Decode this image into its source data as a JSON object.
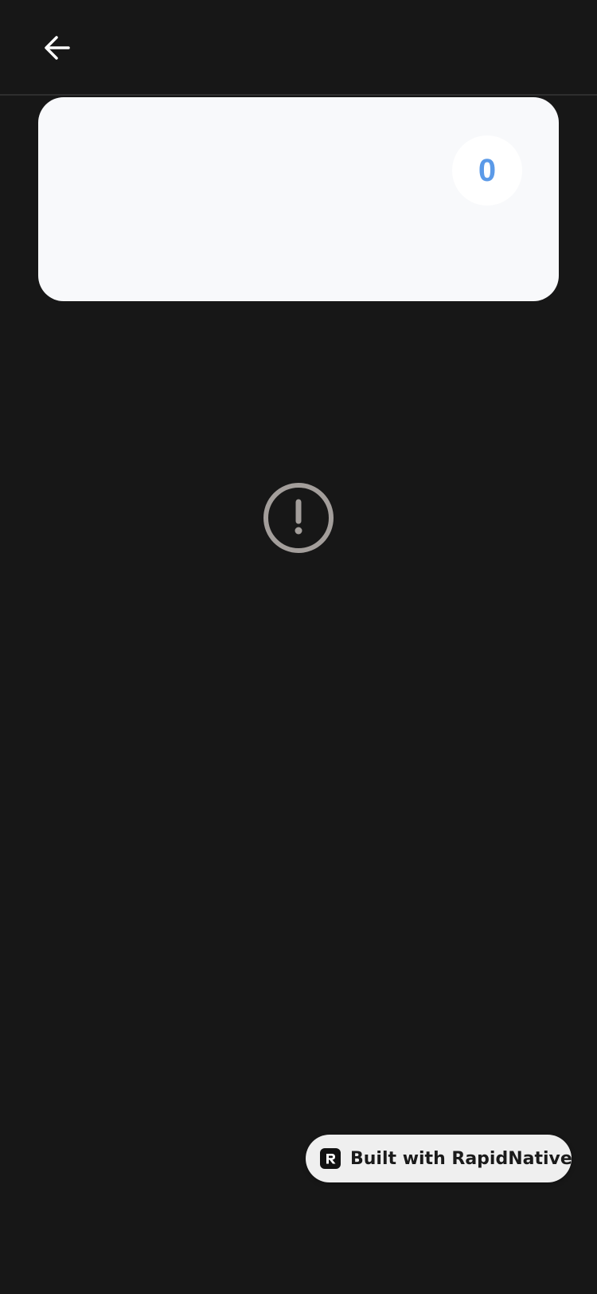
{
  "header": {
    "back_icon": "arrow-left-icon"
  },
  "card": {
    "count": "0",
    "count_color": "#5b9ae8"
  },
  "status": {
    "icon": "alert-circle-icon",
    "icon_color": "#a39e9b"
  },
  "badge": {
    "logo_icon": "rapidnative-logo-icon",
    "label": "Built with RapidNative"
  },
  "colors": {
    "background": "#171717",
    "card": "#f8f9fb",
    "badge_bg": "#efefef"
  }
}
